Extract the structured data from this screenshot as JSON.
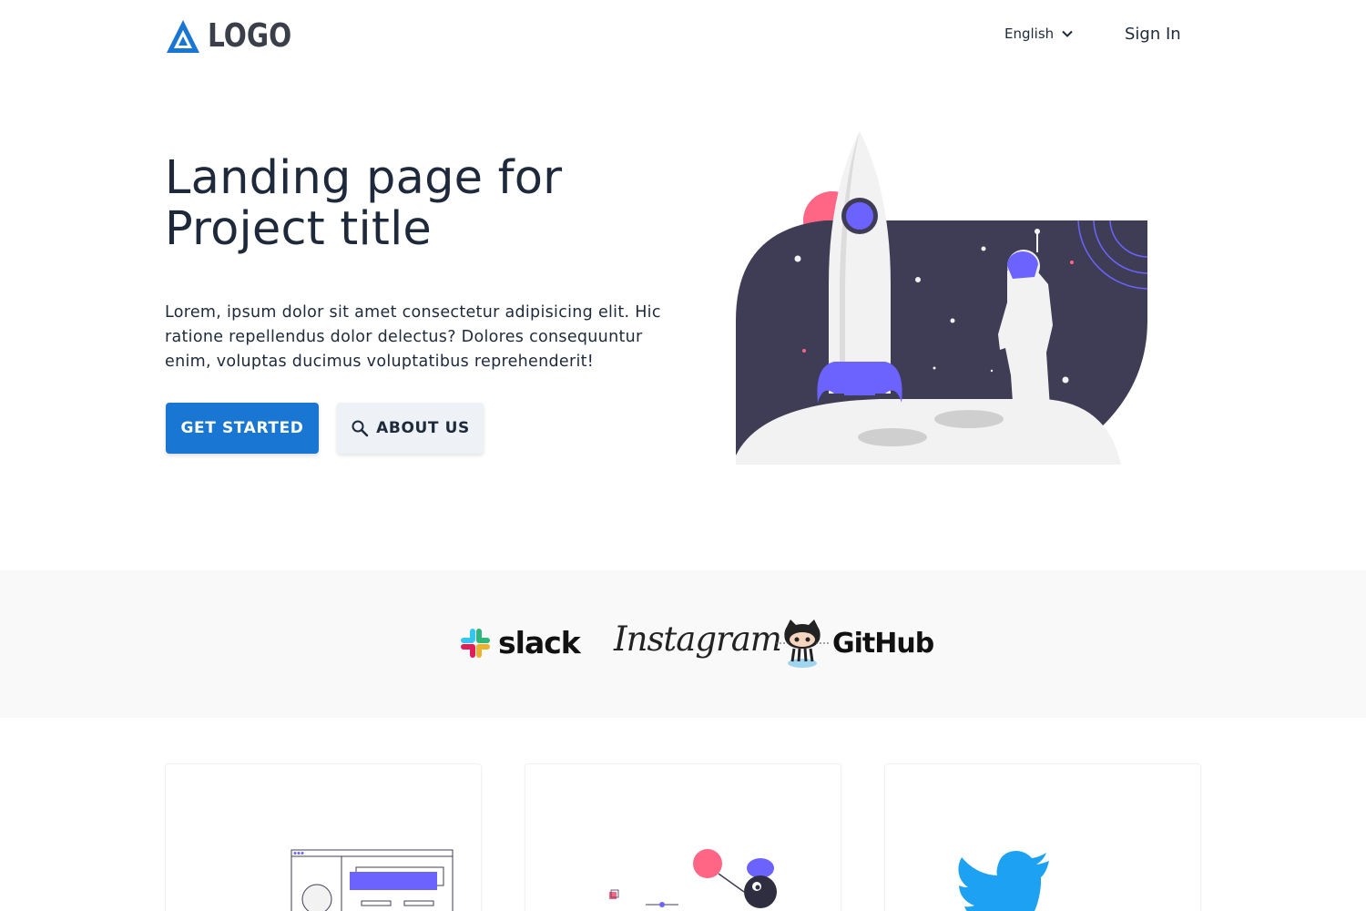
{
  "header": {
    "logo_text": "LOGO",
    "language": "English",
    "signin_label": "Sign In"
  },
  "hero": {
    "title": "Landing page for Project title",
    "description": "Lorem, ipsum dolor sit amet consectetur adipisicing elit. Hic ratione repellendus dolor delectus? Dolores consequuntur enim, voluptas ducimus voluptatibus reprehenderit!",
    "primary_button": "GET STARTED",
    "secondary_button": "ABOUT US"
  },
  "partners": {
    "slack": "slack",
    "instagram": "Instagram",
    "github": "GitHub"
  },
  "colors": {
    "primary": "#1976d2",
    "accent_purple": "#6c63ff",
    "accent_pink": "#ff6584",
    "space": "#3f3d56",
    "twitter": "#1da1f2"
  },
  "icons": {
    "logo": "triangle-logo-icon",
    "language": "chevron-down-icon",
    "about": "search-icon"
  }
}
